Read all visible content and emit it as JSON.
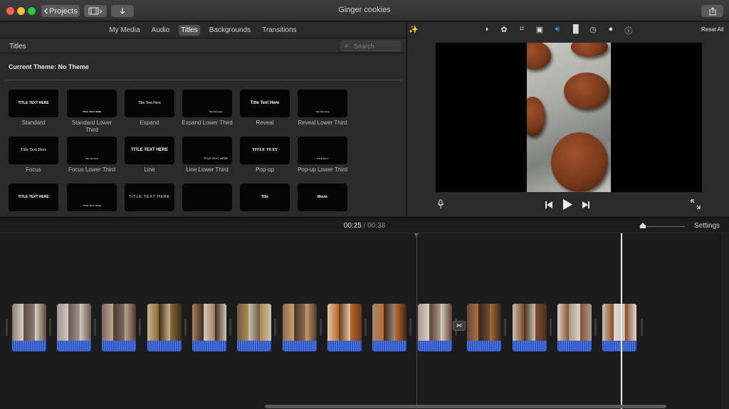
{
  "window": {
    "title": "Ginger cookies"
  },
  "toolbar": {
    "projects_label": "Projects",
    "back_icon": "chevron-left-icon",
    "media_icon": "film-icon",
    "import_icon": "down-arrow-icon",
    "share_icon": "share-icon"
  },
  "browser": {
    "tabs": [
      {
        "label": "My Media",
        "active": false
      },
      {
        "label": "Audio",
        "active": false
      },
      {
        "label": "Titles",
        "active": true
      },
      {
        "label": "Backgrounds",
        "active": false
      },
      {
        "label": "Transitions",
        "active": false
      }
    ],
    "section_title": "Titles",
    "search_placeholder": "Search",
    "current_theme": "Current Theme: No Theme",
    "titles": [
      {
        "label": "Standard",
        "preview": "TITLE TEXT HERE"
      },
      {
        "label": "Standard Lower Third",
        "preview": "TITLE TEXT HERE"
      },
      {
        "label": "Expand",
        "preview": "Title Text Here"
      },
      {
        "label": "Expand Lower Third",
        "preview": "Title Text Here"
      },
      {
        "label": "Reveal",
        "preview": "Title Text Here"
      },
      {
        "label": "Reveal Lower Third",
        "preview": "Title Text Here"
      },
      {
        "label": "Focus",
        "preview": "Title Text Here"
      },
      {
        "label": "Focus Lower Third",
        "preview": "Title Text Here"
      },
      {
        "label": "Line",
        "preview": "TITLE TEXT HERE"
      },
      {
        "label": "Line Lower Third",
        "preview": "TITLE TEXT HERE"
      },
      {
        "label": "Pop-up",
        "preview": "TITLE TEXT"
      },
      {
        "label": "Pop-up Lower Third",
        "preview": "TITLE TEXT"
      },
      {
        "label": "",
        "preview": "TITLE TEXT HERE"
      },
      {
        "label": "",
        "preview": "TITLE TEXT HERE"
      },
      {
        "label": "",
        "preview": "TITLE TEXT HERE"
      },
      {
        "label": "",
        "preview": ""
      },
      {
        "label": "",
        "preview": "Title"
      },
      {
        "label": "",
        "preview": "Movie"
      }
    ]
  },
  "viewer": {
    "reset_label": "Reset All",
    "tool_icons": [
      "magic-wand-icon",
      "color-balance-icon",
      "color-palette-icon",
      "crop-icon",
      "stabilization-camera-icon",
      "volume-icon",
      "equalizer-icon",
      "speed-icon",
      "clip-filter-icon",
      "info-icon"
    ],
    "active_tool": "volume-icon"
  },
  "timeline": {
    "current_time": "00:25",
    "separator": "/",
    "total_time": "00:38",
    "settings_label": "Settings",
    "clips": [
      {
        "colors": [
          "#8a7d70",
          "#d8d0c6",
          "#5c4a3a"
        ]
      },
      {
        "colors": [
          "#9a948c",
          "#cfc9c1",
          "#6a5a4c"
        ]
      },
      {
        "colors": [
          "#7a6a5c",
          "#b9a890",
          "#4e3a2a"
        ]
      },
      {
        "colors": [
          "#c9b48a",
          "#8a6a3a",
          "#3c2a18"
        ]
      },
      {
        "colors": [
          "#a88060",
          "#3a2a1c",
          "#d4c8b4"
        ]
      },
      {
        "colors": [
          "#6a5a48",
          "#b08a4a",
          "#c9c0b0"
        ]
      },
      {
        "colors": [
          "#8c6a50",
          "#c8a070",
          "#4a3828"
        ]
      },
      {
        "colors": [
          "#e0c8a8",
          "#b8682a",
          "#6a3a18"
        ]
      },
      {
        "colors": [
          "#9c8878",
          "#c46a2a",
          "#3e2818"
        ]
      },
      {
        "colors": [
          "#a89888",
          "#d8d0c8",
          "#5a4030"
        ]
      },
      {
        "colors": [
          "#6a4a38",
          "#a8703a",
          "#3a2418"
        ]
      },
      {
        "colors": [
          "#c8c0b4",
          "#7a4a2a",
          "#4a3020"
        ]
      },
      {
        "colors": [
          "#d8d2c8",
          "#8a5030",
          "#a89c8c"
        ]
      },
      {
        "colors": [
          "#c8c0b8",
          "#8a4a28",
          "#e0dad0"
        ]
      }
    ]
  }
}
